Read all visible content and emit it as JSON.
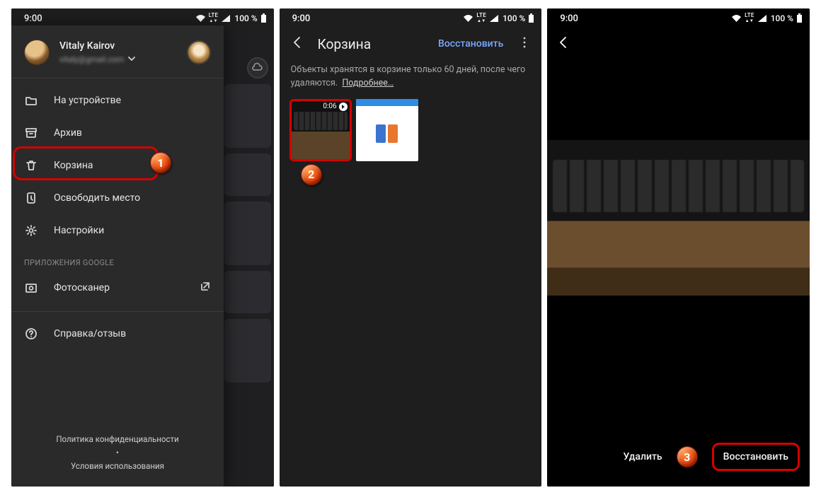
{
  "status": {
    "time": "9:00",
    "network": "LTE",
    "battery": "100 %"
  },
  "drawer": {
    "profile_name": "Vitaly Kairov",
    "profile_email": "vitaly@gmail.com",
    "items": {
      "device": "На устройстве",
      "archive": "Архив",
      "trash": "Корзина",
      "free_space": "Освободить место",
      "settings": "Настройки",
      "section_google": "ПРИЛОЖЕНИЯ GOOGLE",
      "photoscan": "Фотосканер",
      "help": "Справка/отзыв"
    },
    "footer": {
      "privacy": "Политика конфиденциальности",
      "terms": "Условия использования"
    }
  },
  "trash": {
    "title": "Корзина",
    "restore": "Восстановить",
    "info_a": "Объекты хранятся в корзине только 60 дней, после чего удаляются.",
    "info_more": "Подробнее…",
    "video_duration": "0:06"
  },
  "preview": {
    "delete": "Удалить",
    "restore": "Восстановить"
  },
  "markers": {
    "m1": "1",
    "m2": "2",
    "m3": "3"
  }
}
